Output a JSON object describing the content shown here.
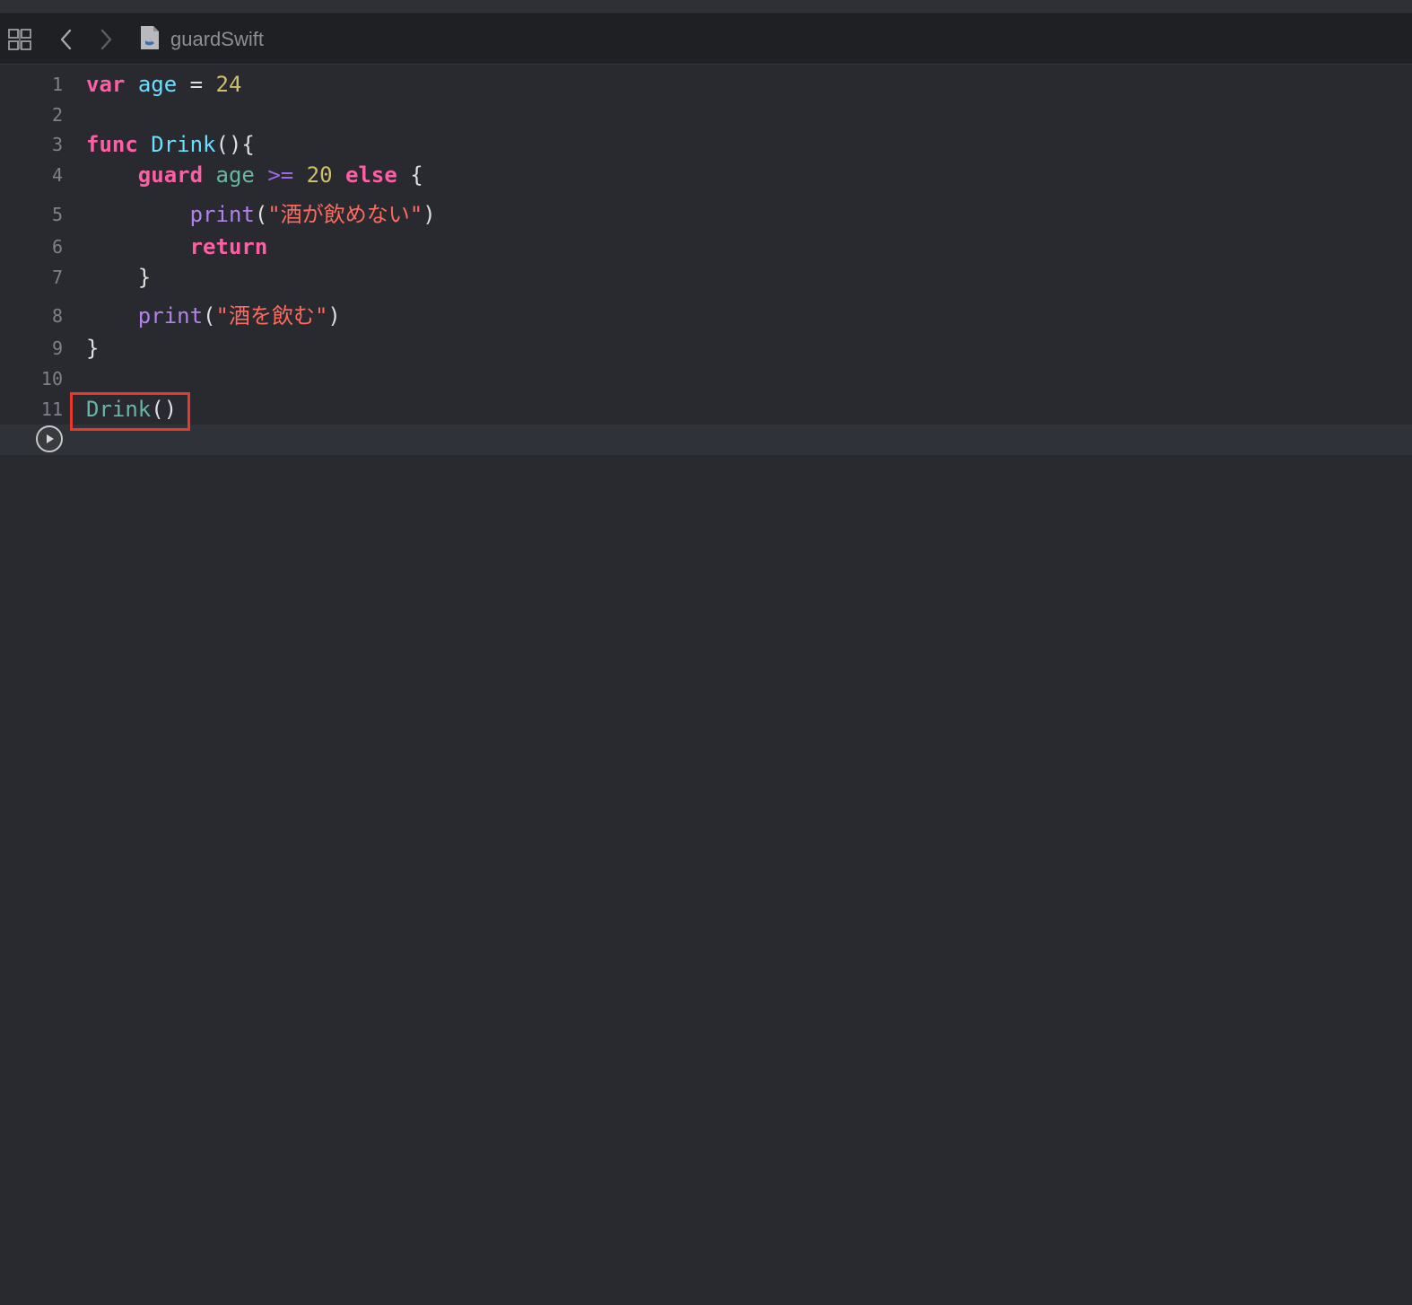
{
  "jumpbar": {
    "file_name": "guardSwift",
    "related_icon": "related-items-grid-icon",
    "back_icon": "chevron-left-icon",
    "forward_icon": "chevron-right-icon",
    "file_icon": "swift-file-icon"
  },
  "editor": {
    "theme_background": "#292a30",
    "lines": [
      {
        "num": "1",
        "tokens": [
          {
            "t": "var",
            "c": "kw"
          },
          {
            "t": " ",
            "c": "plain"
          },
          {
            "t": "age",
            "c": "var"
          },
          {
            "t": " = ",
            "c": "plain"
          },
          {
            "t": "24",
            "c": "num"
          }
        ]
      },
      {
        "num": "2",
        "tokens": []
      },
      {
        "num": "3",
        "tokens": [
          {
            "t": "func",
            "c": "kw"
          },
          {
            "t": " ",
            "c": "plain"
          },
          {
            "t": "Drink",
            "c": "var"
          },
          {
            "t": "(){",
            "c": "plain"
          }
        ]
      },
      {
        "num": "4",
        "tokens": [
          {
            "t": "    ",
            "c": "plain"
          },
          {
            "t": "guard",
            "c": "kw"
          },
          {
            "t": " ",
            "c": "plain"
          },
          {
            "t": "age",
            "c": "fn"
          },
          {
            "t": " ",
            "c": "plain"
          },
          {
            "t": ">=",
            "c": "op"
          },
          {
            "t": " ",
            "c": "plain"
          },
          {
            "t": "20",
            "c": "num"
          },
          {
            "t": " ",
            "c": "plain"
          },
          {
            "t": "else",
            "c": "kw"
          },
          {
            "t": " {",
            "c": "plain"
          }
        ]
      },
      {
        "num": "5",
        "tokens": [
          {
            "t": "        ",
            "c": "plain"
          },
          {
            "t": "print",
            "c": "call"
          },
          {
            "t": "(",
            "c": "plain"
          },
          {
            "t": "\"酒が飲めない\"",
            "c": "str"
          },
          {
            "t": ")",
            "c": "plain"
          }
        ]
      },
      {
        "num": "6",
        "tokens": [
          {
            "t": "        ",
            "c": "plain"
          },
          {
            "t": "return",
            "c": "kw"
          }
        ]
      },
      {
        "num": "7",
        "tokens": [
          {
            "t": "    }",
            "c": "plain"
          }
        ]
      },
      {
        "num": "8",
        "tokens": [
          {
            "t": "    ",
            "c": "plain"
          },
          {
            "t": "print",
            "c": "call"
          },
          {
            "t": "(",
            "c": "plain"
          },
          {
            "t": "\"酒を飲む\"",
            "c": "str"
          },
          {
            "t": ")",
            "c": "plain"
          }
        ]
      },
      {
        "num": "9",
        "tokens": [
          {
            "t": "}",
            "c": "plain"
          }
        ]
      },
      {
        "num": "10",
        "tokens": []
      },
      {
        "num": "11",
        "tokens": [
          {
            "t": "Drink",
            "c": "fn"
          },
          {
            "t": "()",
            "c": "plain"
          }
        ]
      }
    ],
    "highlight_color": "#e8392b",
    "run_icon": "play-circle-icon"
  }
}
